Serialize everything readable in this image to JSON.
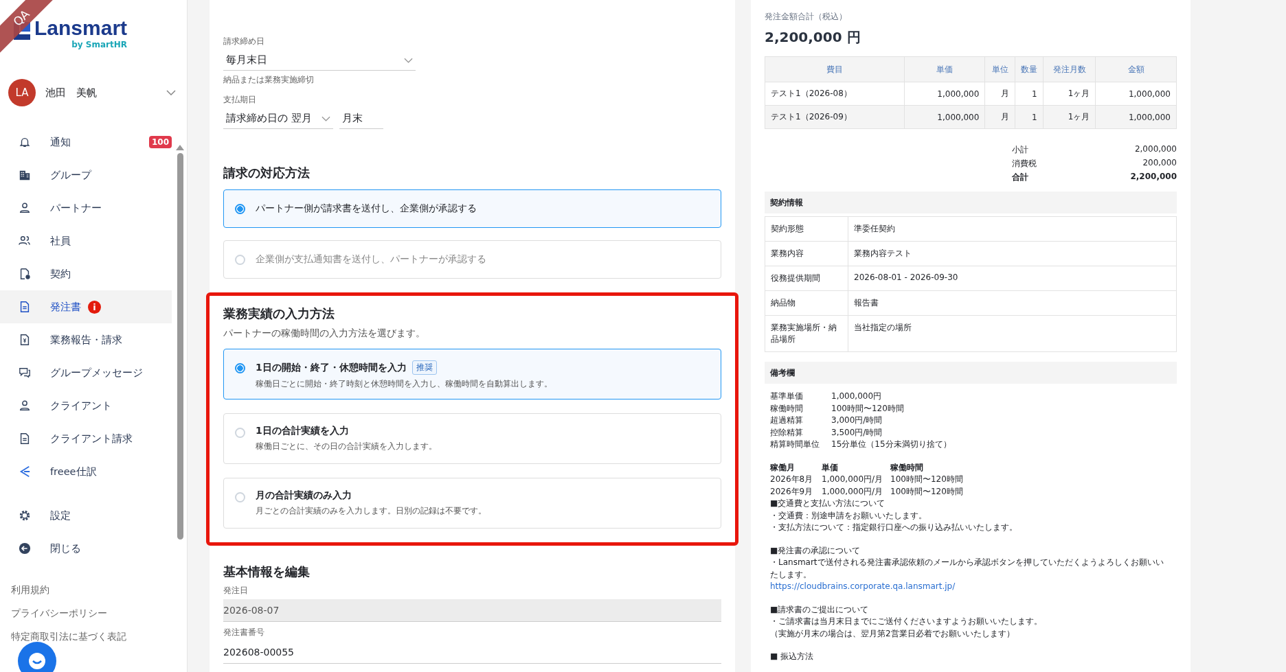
{
  "env_ribbon": "QA",
  "logo": {
    "name": "Lansmart",
    "by": "by SmartHR"
  },
  "user": {
    "initials": "LA",
    "name": "池田　美帆"
  },
  "nav": [
    {
      "label": "通知",
      "selected": false,
      "badge": "100"
    },
    {
      "label": "グループ",
      "selected": false
    },
    {
      "label": "パートナー",
      "selected": false
    },
    {
      "label": "社員",
      "selected": false
    },
    {
      "label": "契約",
      "selected": false
    },
    {
      "label": "発注書",
      "selected": true,
      "alert": "i"
    },
    {
      "label": "業務報告・請求",
      "selected": false
    },
    {
      "label": "グループメッセージ",
      "selected": false
    },
    {
      "label": "クライアント",
      "selected": false
    },
    {
      "label": "クライアント請求",
      "selected": false
    },
    {
      "label": "freee仕訳",
      "selected": false
    }
  ],
  "nav_bottom": [
    {
      "label": "設定",
      "selected": false
    },
    {
      "label": "閉じる",
      "selected": false
    }
  ],
  "footer_links": [
    "利用規約",
    "プライバシーポリシー",
    "特定商取引法に基づく表記"
  ],
  "form": {
    "closing_day": {
      "label": "請求締め日",
      "value": "毎月末日",
      "hint": "納品または業務実施締切"
    },
    "payment_due": {
      "label": "支払期日",
      "value": "請求締め日の 翌月",
      "day": "月末"
    },
    "billing_method": {
      "title": "請求の対応方法",
      "options": [
        {
          "label": "パートナー側が請求書を送付し、企業側が承認する",
          "selected": true,
          "disabled": false
        },
        {
          "label": "企業側が支払通知書を送付し、パートナーが承認する",
          "selected": false,
          "disabled": true
        }
      ]
    },
    "work_input": {
      "title": "業務実績の入力方法",
      "description": "パートナーの稼働時間の入力方法を選びます。",
      "highlighted": true,
      "options": [
        {
          "title": "1日の開始・終了・休憩時間を入力",
          "tag": "推奨",
          "description": "稼働日ごとに開始・終了時刻と休憩時間を入力し、稼働時間を自動算出します。",
          "selected": true
        },
        {
          "title": "1日の合計実績を入力",
          "description": "稼働日ごとに、その日の合計実績を入力します。",
          "selected": false
        },
        {
          "title": "月の合計実績のみ入力",
          "description": "月ごとの合計実績のみを入力します。日別の記録は不要です。",
          "selected": false
        }
      ]
    },
    "basic_info": {
      "title": "基本情報を編集",
      "fields": [
        {
          "label": "発注日",
          "value": "2026-08-07",
          "disabled": true
        },
        {
          "label": "発注書番号",
          "value": "202608-00055",
          "disabled": false
        }
      ]
    }
  },
  "summary": {
    "total_label": "発注金額合計（税込）",
    "total": "2,200,000 円",
    "items": {
      "columns": [
        "費目",
        "単価",
        "単位",
        "数量",
        "発注月数",
        "金額"
      ],
      "rows": [
        [
          "テスト1（2026-08）",
          "1,000,000",
          "月",
          "1",
          "1ヶ月",
          "1,000,000"
        ],
        [
          "テスト1（2026-09）",
          "1,000,000",
          "月",
          "1",
          "1ヶ月",
          "1,000,000"
        ]
      ]
    },
    "totals": [
      {
        "label": "小計",
        "value": "2,000,000",
        "bold": false
      },
      {
        "label": "消費税",
        "value": "200,000",
        "bold": false
      },
      {
        "label": "合計",
        "value": "2,200,000",
        "bold": true
      }
    ],
    "contract": {
      "title": "契約情報",
      "rows": [
        {
          "label": "契約形態",
          "value": "準委任契約"
        },
        {
          "label": "業務内容",
          "value": "業務内容テスト"
        },
        {
          "label": "役務提供期間",
          "value": "2026-08-01 - 2026-09-30"
        },
        {
          "label": "納品物",
          "value": "報告書"
        },
        {
          "label": "業務実施場所・納品場所",
          "value": "当社指定の場所"
        }
      ]
    },
    "remarks": {
      "title": "備考欄",
      "terms": [
        {
          "label": "基準単価",
          "value": "1,000,000円"
        },
        {
          "label": "稼働時間",
          "value": "100時間〜120時間"
        },
        {
          "label": "超過精算",
          "value": "3,000円/時間"
        },
        {
          "label": "控除精算",
          "value": "3,500円/時間"
        },
        {
          "label": "精算時間単位",
          "value": "15分単位（15分未満切り捨て）"
        }
      ],
      "monthly": {
        "columns": [
          "稼働月",
          "単価",
          "稼働時間"
        ],
        "rows": [
          [
            "2026年8月",
            "1,000,000円/月",
            "100時間〜120時間"
          ],
          [
            "2026年9月",
            "1,000,000円/月",
            "100時間〜120時間"
          ]
        ]
      },
      "paragraphs": [
        {
          "lines": [
            {
              "kind": "text",
              "text": "■交通費と支払い方法について"
            },
            {
              "kind": "text",
              "text": "・交通費：別途申請をお願いいたします。"
            },
            {
              "kind": "text",
              "text": "・支払方法について：指定銀行口座への振り込み払いいたします。"
            }
          ]
        },
        {
          "lines": [
            {
              "kind": "text",
              "text": "■発注書の承認について"
            },
            {
              "kind": "text",
              "text": "・Lansmartで送付される発注書承認依頼のメールから承認ボタンを押していただくようよろしくお願いいたします。"
            },
            {
              "kind": "link",
              "text": "https://cloudbrains.corporate.qa.lansmart.jp/"
            }
          ]
        },
        {
          "lines": [
            {
              "kind": "text",
              "text": "■請求書のご提出について"
            },
            {
              "kind": "text",
              "text": "・ご請求書は当月末日までにご送付くださいますようお願いいたします。"
            },
            {
              "kind": "text",
              "text": "（実施が月末の場合は、翌月第2営業日必着でお願いいたします）"
            }
          ]
        },
        {
          "lines": [
            {
              "kind": "text",
              "text": "■ 振込方法"
            }
          ]
        }
      ]
    }
  }
}
